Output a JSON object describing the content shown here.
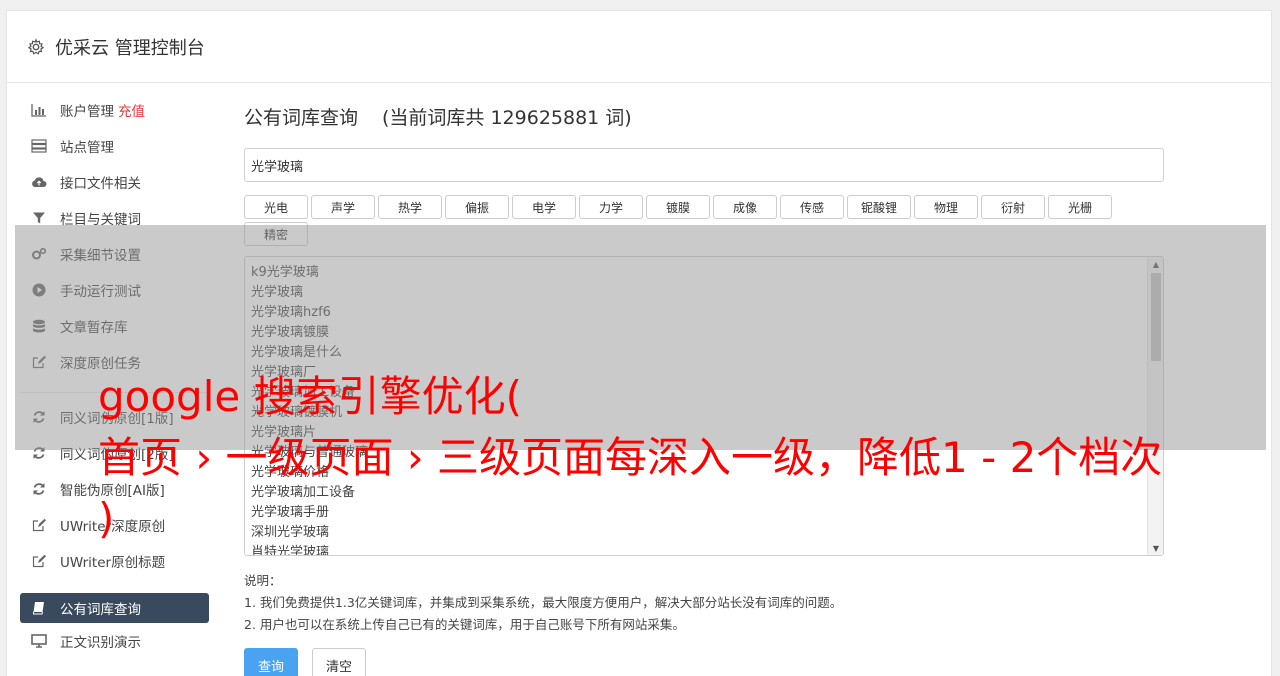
{
  "header": {
    "title": "优采云 管理控制台",
    "icon": "gear-icon"
  },
  "sidebar": {
    "items": [
      {
        "label": "账户管理",
        "badge": "充值",
        "icon": "bar-chart-icon"
      },
      {
        "label": "站点管理",
        "icon": "server-icon"
      },
      {
        "label": "接口文件相关",
        "icon": "cloud-upload-icon"
      },
      {
        "label": "栏目与关键词",
        "icon": "filter-icon"
      },
      {
        "label": "采集细节设置",
        "icon": "gears-icon"
      },
      {
        "label": "手动运行测试",
        "icon": "play-circle-icon"
      },
      {
        "label": "文章暂存库",
        "icon": "database-icon"
      },
      {
        "label": "深度原创任务",
        "icon": "edit-icon"
      }
    ],
    "items2": [
      {
        "label": "同义词伪原创[1版]",
        "icon": "refresh-icon"
      },
      {
        "label": "同义词伪原创[2版]",
        "icon": "refresh-icon"
      },
      {
        "label": "智能伪原创[AI版]",
        "icon": "refresh-icon"
      },
      {
        "label": "UWriter深度原创",
        "icon": "edit-icon"
      },
      {
        "label": "UWriter原创标题",
        "icon": "edit-icon"
      }
    ],
    "active": {
      "label": "公有词库查询",
      "icon": "book-icon"
    },
    "after": {
      "label": "正文识别演示",
      "icon": "monitor-icon"
    }
  },
  "main": {
    "title": "公有词库查询",
    "count_text": "(当前词库共 129625881 词)",
    "keyword_value": "光学玻璃",
    "categories": [
      "光电",
      "声学",
      "热学",
      "偏振",
      "电学",
      "力学",
      "镀膜",
      "成像",
      "传感",
      "铌酸锂",
      "物理",
      "衍射",
      "光栅",
      "精密"
    ],
    "results": [
      "k9光学玻璃",
      "光学玻璃",
      "光学玻璃hzf6",
      "光学玻璃镀膜",
      "光学玻璃是什么",
      "光学玻璃厂",
      "光学玻璃加工设备",
      "光学玻璃镀膜机",
      "光学玻璃片",
      "光学玻璃与普通玻璃",
      "光学玻璃价格",
      "光学玻璃加工设备",
      "光学玻璃手册",
      "深圳光学玻璃",
      "肖特光学玻璃"
    ],
    "notes": {
      "label": "说明：",
      "line1": "1. 我们免费提供1.3亿关键词库，并集成到采集系统，最大限度方便用户，解决大部分站长没有词库的问题。",
      "line2": "2. 用户也可以在系统上传自己已有的关键词库，用于自己账号下所有网站采集。"
    },
    "query_label": "查询",
    "clear_label": "清空"
  },
  "overlay": {
    "line1": "google 搜索引擎优化(",
    "line2": "首页 › 一级页面 › 三级页面每深入一级，降低1 - 2个档次",
    "line3": ")"
  }
}
